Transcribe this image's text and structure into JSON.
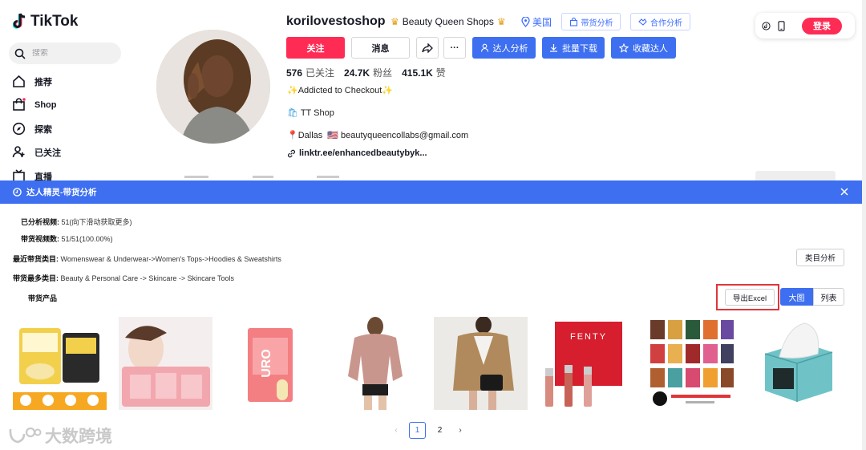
{
  "sidebar": {
    "logo": "TikTok",
    "search_placeholder": "搜索",
    "items": [
      {
        "label": "推荐"
      },
      {
        "label": "Shop"
      },
      {
        "label": "探索"
      },
      {
        "label": "已关注"
      },
      {
        "label": "直播"
      }
    ]
  },
  "profile": {
    "username": "korilovestoshop",
    "shop_name": "Beauty Queen Shops",
    "region": "美国",
    "btn_commerce_analysis": "带货分析",
    "btn_collab_analysis": "合作分析",
    "btn_follow": "关注",
    "btn_message": "消息",
    "btn_creator_analysis": "达人分析",
    "btn_bulk_download": "批量下载",
    "btn_favorite_creator": "收藏达人",
    "following_count": "576",
    "following_label": "已关注",
    "followers_count": "24.7K",
    "followers_label": "粉丝",
    "likes_count": "415.1K",
    "likes_label": "赞",
    "bio_line1": "Addicted to Checkout",
    "bio_line2": "TT Shop",
    "bio_line3_city": "Dallas",
    "bio_line3_email": "beautyqueencollabs@gmail.com",
    "link": "linktr.ee/enhancedbeautybyk..."
  },
  "topbar": {
    "login": "登录"
  },
  "panel": {
    "title": "达人精灵-带货分析",
    "analyzed_videos_label": "已分析视频",
    "analyzed_videos_value": "51(向下滑动获取更多)",
    "commerce_videos_label": "带货视频数",
    "commerce_videos_value": "51/51(100.00%)",
    "recent_category_label": "最近带货类目",
    "recent_category_value": "Womenswear & Underwear->Women's Tops->Hoodies & Sweatshirts",
    "top_category_label": "带货最多类目",
    "top_category_value": "Beauty & Personal Care -> Skincare -> Skincare Tools",
    "products_label": "带货产品",
    "btn_category_analysis": "类目分析",
    "btn_export_excel": "导出Excel",
    "btn_grid_view": "大图",
    "btn_list_view": "列表"
  },
  "products": [
    {
      "name": "protein-powder-product"
    },
    {
      "name": "face-mask-product"
    },
    {
      "name": "boric-acid-product"
    },
    {
      "name": "pink-sweatshirt-product"
    },
    {
      "name": "knit-cardigan-product"
    },
    {
      "name": "fenty-lip-gloss-product"
    },
    {
      "name": "glamlite-palette-product"
    },
    {
      "name": "face-towel-box-product"
    }
  ],
  "pagination": {
    "pages": [
      "1",
      "2"
    ],
    "current": "1"
  },
  "watermark": "大数跨境",
  "colors": {
    "tiktok_red": "#fe2c55",
    "panel_blue": "#3d6ff0",
    "highlight_red": "#e0363a"
  }
}
